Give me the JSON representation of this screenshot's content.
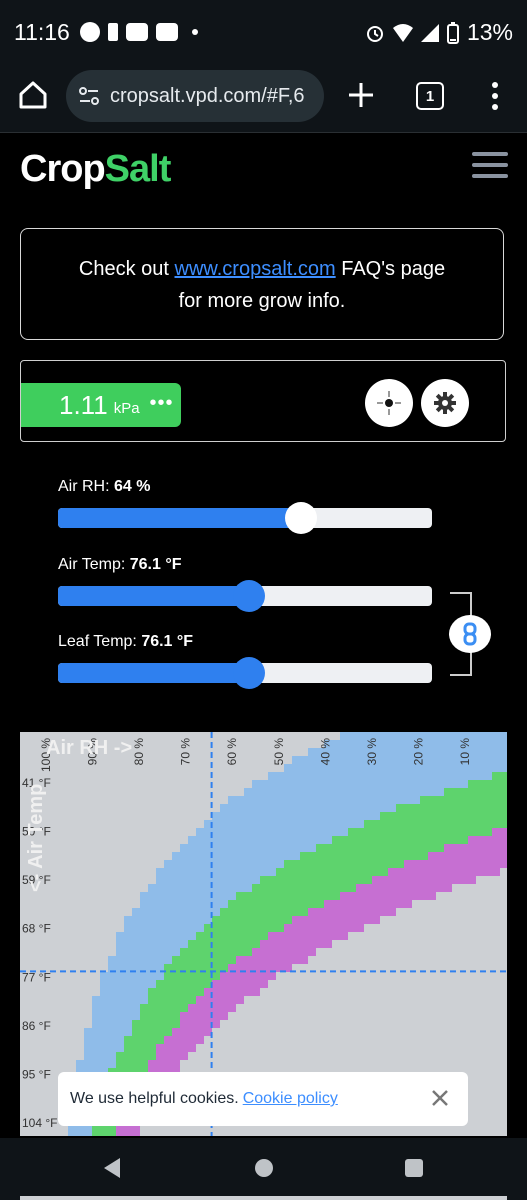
{
  "status": {
    "time": "11:16",
    "battery": "13%"
  },
  "browser": {
    "url": "cropsalt.vpd.com/#F,6",
    "tab_count": "1"
  },
  "header": {
    "logo_crop": "Cr",
    "logo_o": "o",
    "logo_p": "p",
    "logo_salt": "Salt"
  },
  "info": {
    "prefix": "Check out ",
    "link": "www.cropsalt.com",
    "suffix": " FAQ's page",
    "line2": "for more grow info."
  },
  "vpd": {
    "value": "1.11",
    "unit": "kPa",
    "more": "•••"
  },
  "sliders": {
    "rh": {
      "label": "Air RH: ",
      "value": "64 %",
      "fraction": 0.65
    },
    "air": {
      "label": "Air Temp: ",
      "value": "76.1 °F",
      "fraction": 0.51
    },
    "leaf": {
      "label": "Leaf Temp: ",
      "value": "76.1 °F",
      "fraction": 0.51
    }
  },
  "chart_data": {
    "type": "heatmap",
    "x_axis_title": "Air RH ->",
    "y_axis_title": "<- Air Temp",
    "x_ticks": [
      "100 %",
      "90 %",
      "80 %",
      "70 %",
      "60 %",
      "50 %",
      "40 %",
      "30 %",
      "20 %",
      "10 %"
    ],
    "y_ticks": [
      "41 °F",
      "50 °F",
      "59 °F",
      "68 °F",
      "77 °F",
      "86 °F",
      "95 °F",
      "104 °F"
    ],
    "crosshair": {
      "rh": 64,
      "temp_f": 76.1
    },
    "zone_colors": [
      "#cdd0d4",
      "#8fbce9",
      "#5ed36d",
      "#c66fd2"
    ]
  },
  "cookie": {
    "text": "We use helpful cookies.",
    "link": "Cookie policy"
  }
}
